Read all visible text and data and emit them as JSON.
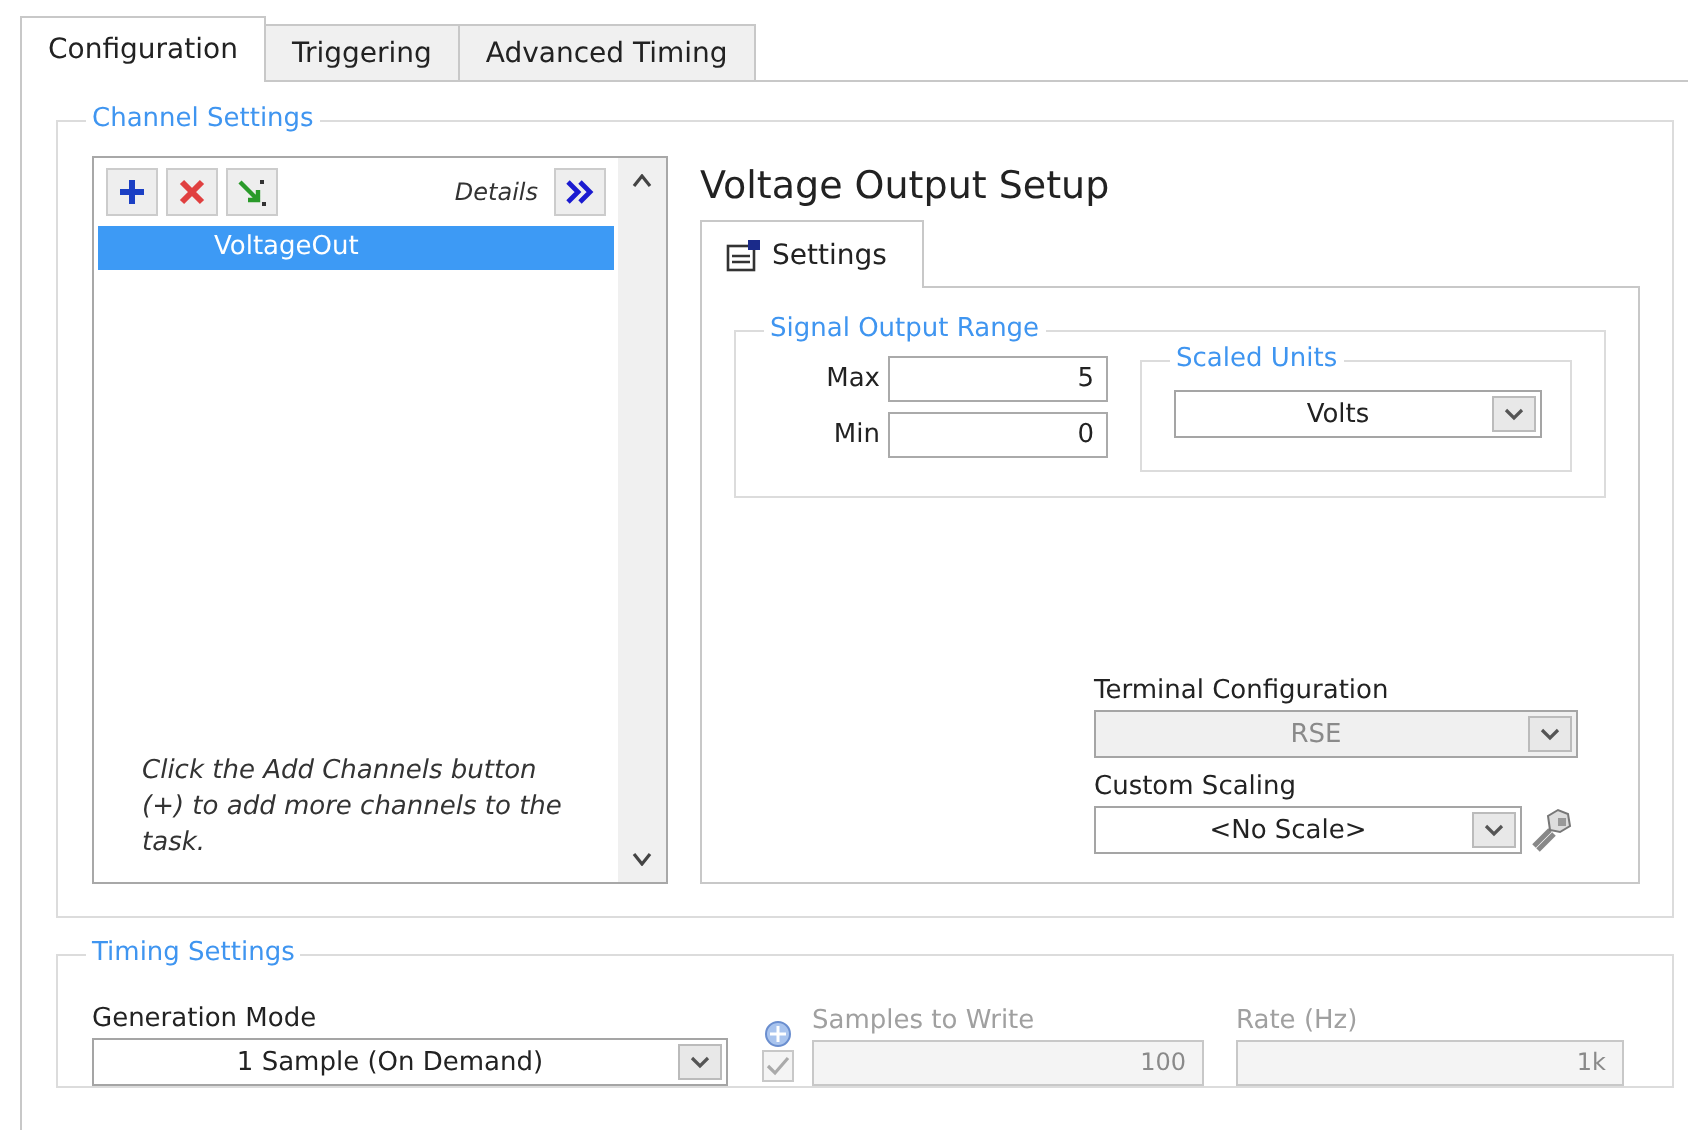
{
  "tabs": [
    {
      "label": "Configuration",
      "selected": true
    },
    {
      "label": "Triggering",
      "selected": false
    },
    {
      "label": "Advanced Timing",
      "selected": false
    }
  ],
  "channel_settings": {
    "title": "Channel Settings",
    "details_label": "Details",
    "channels": [
      {
        "name": "VoltageOut",
        "selected": true
      }
    ],
    "hint": "Click the Add Channels button (+) to add more channels to the task."
  },
  "voltage_setup": {
    "title": "Voltage Output Setup",
    "tabs": [
      {
        "label": "Settings",
        "selected": true
      }
    ],
    "signal_output_range": {
      "title": "Signal Output Range",
      "max": {
        "label": "Max",
        "value": "5"
      },
      "min": {
        "label": "Min",
        "value": "0"
      }
    },
    "scaled_units": {
      "title": "Scaled Units",
      "value": "Volts"
    },
    "terminal_configuration": {
      "label": "Terminal Configuration",
      "value": "RSE",
      "disabled": true
    },
    "custom_scaling": {
      "label": "Custom Scaling",
      "value": "<No Scale>",
      "disabled": false
    }
  },
  "timing_settings": {
    "title": "Timing Settings",
    "generation_mode": {
      "label": "Generation Mode",
      "value": "1 Sample (On Demand)",
      "disabled": false
    },
    "regenerate": {
      "checked": true,
      "disabled": true
    },
    "samples_to_write": {
      "label": "Samples to Write",
      "value": "100",
      "disabled": true
    },
    "rate": {
      "label": "Rate (Hz)",
      "value": "1k",
      "disabled": true
    }
  }
}
